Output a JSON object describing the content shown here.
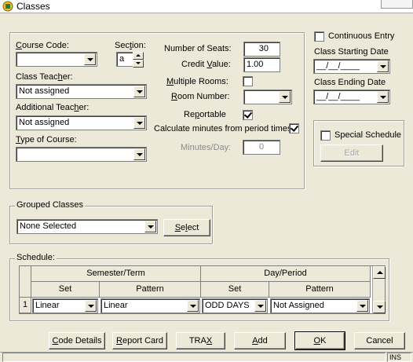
{
  "window": {
    "title": "Classes",
    "icon": "app-icon"
  },
  "course": {
    "course_code_label": "Course Code:",
    "course_code_value": "",
    "section_label": "Section:",
    "section_value": "a",
    "class_teacher_label": "Class Teacher:",
    "class_teacher_value": "Not assigned",
    "additional_teacher_label": "Additional Teacher:",
    "additional_teacher_value": "Not assigned",
    "type_label": "Type of Course:",
    "type_value": ""
  },
  "seats": {
    "seats_label": "Number of Seats:",
    "seats_value": "30",
    "credit_label": "Credit Value:",
    "credit_value": "1.00",
    "multiple_rooms_label": "Multiple Rooms:",
    "multiple_rooms_checked": false,
    "room_label": "Room Number:",
    "room_value": "",
    "reportable_label": "Reportable",
    "reportable_checked": true,
    "calc_minutes_label": "Calculate minutes from period times",
    "calc_minutes_checked": true,
    "minutes_label": "Minutes/Day:",
    "minutes_value": "0"
  },
  "side": {
    "continuous_label": "Continuous Entry",
    "continuous_checked": false,
    "start_label": "Class Starting Date",
    "start_value": "__/__/____",
    "end_label": "Class Ending Date",
    "end_value": "__/__/____",
    "special_label": "Special Schedule",
    "special_checked": false,
    "edit_label": "Edit"
  },
  "grouped": {
    "label": "Grouped Classes",
    "value": "None Selected",
    "select_label": "Select"
  },
  "schedule": {
    "label": "Schedule:",
    "group_headers": [
      "Semester/Term",
      "Day/Period"
    ],
    "col_headers": [
      "Set",
      "Pattern",
      "Set",
      "Pattern"
    ],
    "rows": [
      {
        "num": "1",
        "cells": [
          "Linear",
          "Linear",
          "ODD DAYS",
          "Not Assigned"
        ]
      }
    ]
  },
  "buttons": {
    "code_details": "Code Details",
    "report_card": "Report Card",
    "trax": "TRAX",
    "add": "Add",
    "ok": "OK",
    "cancel": "Cancel"
  },
  "status": {
    "ins": "INS"
  }
}
